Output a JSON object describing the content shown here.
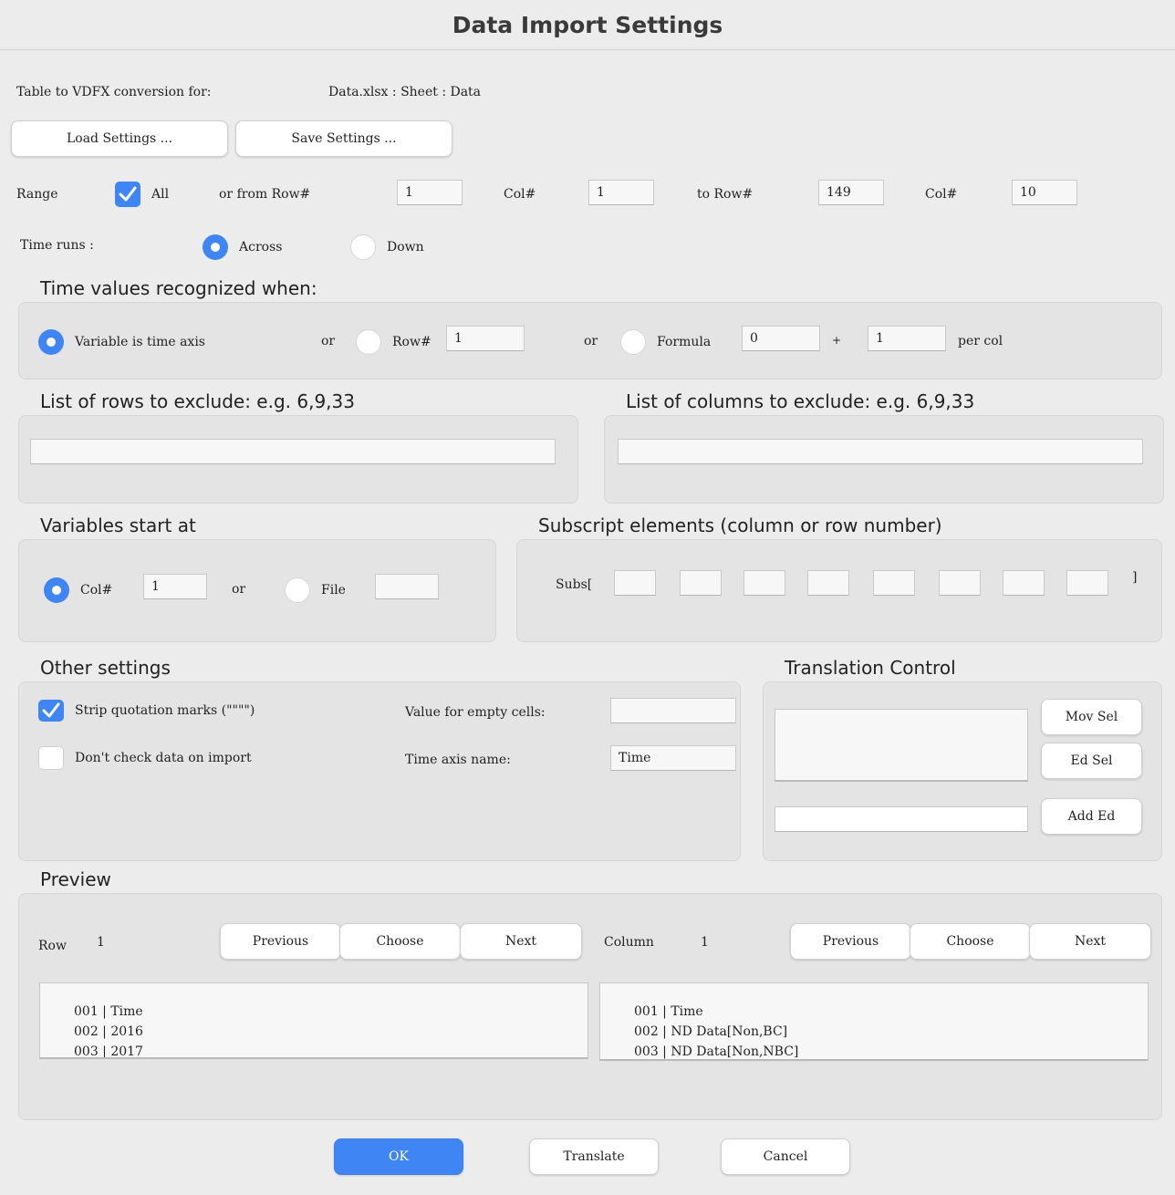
{
  "window": {
    "title": "Data Import Settings"
  },
  "header": {
    "conversion_label": "Table to VDFX conversion for:",
    "source": "Data.xlsx : Sheet : Data"
  },
  "buttons": {
    "load_settings": "Load Settings ...",
    "save_settings": "Save Settings ..."
  },
  "range": {
    "label": "Range",
    "all_label": "All",
    "all_checked": true,
    "from_row_label": "or from Row#",
    "from_row": "1",
    "col_label": "Col#",
    "from_col": "1",
    "to_row_label": "to Row#",
    "to_row": "149",
    "to_col_label": "Col#",
    "to_col": "10"
  },
  "time_runs": {
    "label": "Time runs :",
    "across_label": "Across",
    "down_label": "Down",
    "selected": "Across"
  },
  "time_values": {
    "heading": "Time values recognized when:",
    "variable_label": "Variable is time axis",
    "or1": "or",
    "row_label": "Row#",
    "row_value": "1",
    "or2": "or",
    "formula_label": "Formula",
    "formula_start": "0",
    "plus": "+",
    "formula_step": "1",
    "per_col": "per col",
    "selected": "Variable is time axis"
  },
  "exclude": {
    "rows_heading": "List of rows to exclude: e.g. 6,9,33",
    "rows_value": "",
    "cols_heading": "List of columns to exclude:  e.g. 6,9,33",
    "cols_value": ""
  },
  "variables_start": {
    "heading": "Variables start at",
    "col_label": "Col#",
    "col_value": "1",
    "or": "or",
    "file_label": "File",
    "file_value": "",
    "selected": "Col#"
  },
  "subscripts": {
    "heading": "Subscript elements (column or row number)",
    "prefix": "Subs[",
    "suffix": "]",
    "values": [
      "",
      "",
      "",
      "",
      "",
      "",
      "",
      ""
    ]
  },
  "other_settings": {
    "heading": "Other settings",
    "strip_quotes_label": "Strip quotation marks (\"\"\"\")",
    "strip_quotes_checked": true,
    "dont_check_label": "Don't check data on import",
    "dont_check_checked": false,
    "empty_cells_label": "Value for empty cells:",
    "empty_cells_value": "",
    "time_axis_label": "Time axis name:",
    "time_axis_value": "Time"
  },
  "translation": {
    "heading": "Translation Control",
    "mov_sel": "Mov Sel",
    "ed_sel": "Ed Sel",
    "add_ed": "Add Ed",
    "edit_value": ""
  },
  "preview": {
    "heading": "Preview",
    "row_label": "Row",
    "row_value": "1",
    "row_prev": "Previous",
    "row_choose": "Choose",
    "row_next": "Next",
    "col_label": "Column",
    "col_value": "1",
    "col_prev": "Previous",
    "col_choose": "Choose",
    "col_next": "Next",
    "row_items": [
      "001 |  Time",
      "002 |  2016",
      "003 |  2017"
    ],
    "col_items": [
      "001 |  Time",
      "002 |  ND Data[Non,BC]",
      "003 |  ND Data[Non,NBC]"
    ]
  },
  "footer": {
    "ok": "OK",
    "translate": "Translate",
    "cancel": "Cancel"
  },
  "colors": {
    "accent": "#3f86f4",
    "background": "#ececec",
    "panel": "#e4e4e4"
  }
}
